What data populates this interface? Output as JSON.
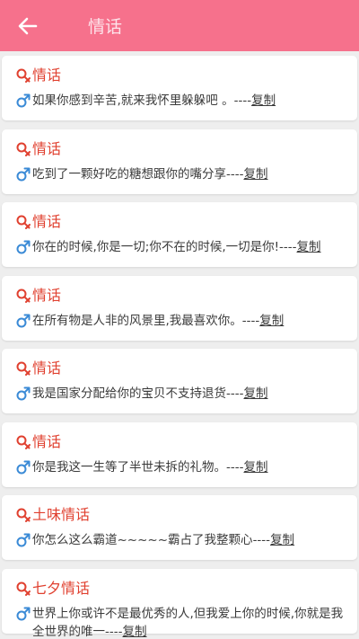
{
  "header": {
    "title": "情话",
    "back_icon": "arrow-left-icon",
    "background": "#f6718c"
  },
  "colors": {
    "title_red": "#e0402f",
    "male_blue": "#3a8ad6",
    "text": "#3a3a3a"
  },
  "items": [
    {
      "title": "情话",
      "text": "如果你感到辛苦,就来我怀里躲躲吧 。",
      "sep": "----",
      "copy": "复制"
    },
    {
      "title": "情话",
      "text": "吃到了一颗好吃的糖想跟你的嘴分享",
      "sep": "----",
      "copy": "复制"
    },
    {
      "title": "情话",
      "text": "你在的时候,你是一切;你不在的时候,一切是你!",
      "sep": "----",
      "copy": "复制"
    },
    {
      "title": "情话",
      "text": "在所有物是人非的风景里,我最喜欢你。",
      "sep": "----",
      "copy": "复制"
    },
    {
      "title": "情话",
      "text": "我是国家分配给你的宝贝不支持退货",
      "sep": "----",
      "copy": "复制"
    },
    {
      "title": "情话",
      "text": "你是我这一生等了半世未拆的礼物。",
      "sep": "----",
      "copy": "复制"
    },
    {
      "title": "土味情话",
      "text": "你怎么这么霸道~~~~~霸占了我整颗心",
      "sep": "----",
      "copy": "复制"
    },
    {
      "title": "七夕情话",
      "text": "世界上你或许不是最优秀的人,但我爱上你的时候,你就是我全世界的唯一",
      "sep": "----",
      "copy": "复制"
    }
  ]
}
